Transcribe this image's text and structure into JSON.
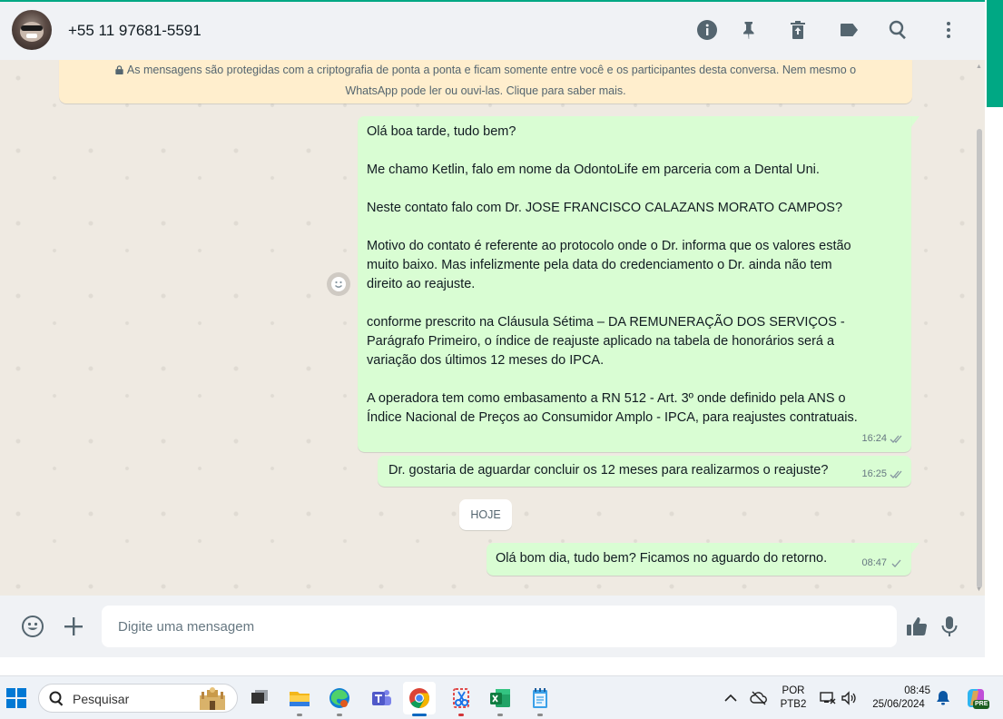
{
  "header": {
    "contact_name": "+55 11 97681-5591",
    "icons": [
      "info-icon",
      "pin-icon",
      "delete-icon",
      "label-icon",
      "search-icon",
      "menu-icon"
    ]
  },
  "encryption_notice": {
    "line1": "As mensagens são protegidas com a criptografia de ponta a ponta e ficam somente entre você e os participantes desta conversa. Nem mesmo o",
    "line2": "WhatsApp pode ler ou ouvi-las. Clique para saber mais."
  },
  "messages": [
    {
      "paragraphs": [
        "Olá boa tarde, tudo bem?",
        "",
        "Me chamo Ketlin, falo em nome da OdontoLife em parceria com a Dental Uni.",
        "",
        "Neste contato falo com Dr. JOSE FRANCISCO CALAZANS MORATO CAMPOS?",
        "",
        "Motivo do contato é referente ao protocolo onde o Dr. informa que os valores estão",
        "muito baixo. Mas infelizmente pela data do credenciamento o Dr. ainda não tem",
        "direito ao reajuste.",
        "",
        "conforme prescrito na Cláusula Sétima – DA REMUNERAÇÃO DOS SERVIÇOS -",
        "Parágrafo Primeiro, o índice de reajuste aplicado na tabela de honorários será a",
        "variação dos últimos 12 meses do IPCA.",
        "",
        "A operadora tem como embasamento a RN 512 - Art. 3º onde definido pela ANS o",
        "Índice Nacional de Preços ao Consumidor Amplo - IPCA, para reajustes contratuais."
      ],
      "time": "16:24",
      "status": "read"
    },
    {
      "text": "Dr. gostaria de aguardar concluir os 12 meses para realizarmos o reajuste?",
      "time": "16:25",
      "status": "read"
    },
    {
      "text": "Olá bom dia, tudo bem? Ficamos no aguardo do retorno.",
      "time": "08:47",
      "status": "sent"
    }
  ],
  "day_separator": "HOJE",
  "composer": {
    "placeholder": "Digite uma mensagem"
  },
  "taskbar": {
    "search_label": "Pesquisar",
    "apps": [
      "task-view",
      "file-explorer",
      "edge",
      "teams",
      "chrome",
      "snipping-tool",
      "excel",
      "notepad"
    ],
    "language_line1": "POR",
    "language_line2": "PTB2",
    "time": "08:45",
    "date": "25/06/2024",
    "copilot_badge": "PRE"
  },
  "colors": {
    "accent": "#00a884",
    "outgoing_bubble": "#d9fdd3",
    "notice_bg": "#ffeecd",
    "read_ticks": "#53bdeb",
    "icon_gray": "#54656f"
  }
}
